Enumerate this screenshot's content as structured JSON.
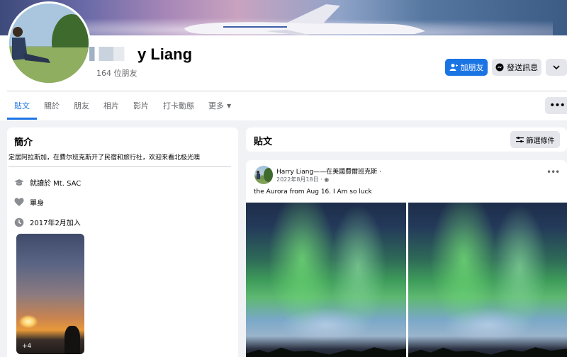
{
  "profile": {
    "name_visible": "y Liang",
    "friends_count": "164 位朋友"
  },
  "actions": {
    "add_friend": "加朋友",
    "send_message": "發送訊息"
  },
  "tabs": [
    "貼文",
    "關於",
    "朋友",
    "相片",
    "影片",
    "打卡動態",
    "更多"
  ],
  "intro": {
    "title": "簡介",
    "bio": "定居阿拉斯加，在費尔班克斯开了民宿和旅行社，欢迎来看北极光噢",
    "education": "就讀於 Mt. SAC",
    "relationship": "單身",
    "joined": "2017年2月加入",
    "photo_more": "+4"
  },
  "posts": {
    "title": "貼文",
    "filter_label": "篩選條件",
    "post": {
      "author": "Harry Liang——在美國費爾班克斯",
      "date": "2022年8月18日 ·",
      "text": "the Aurora from Aug 16. I Am so luck"
    }
  },
  "colors": {
    "accent": "#1b74e4",
    "secondary_button": "#e4e6eb",
    "background": "#f0f2f5"
  }
}
